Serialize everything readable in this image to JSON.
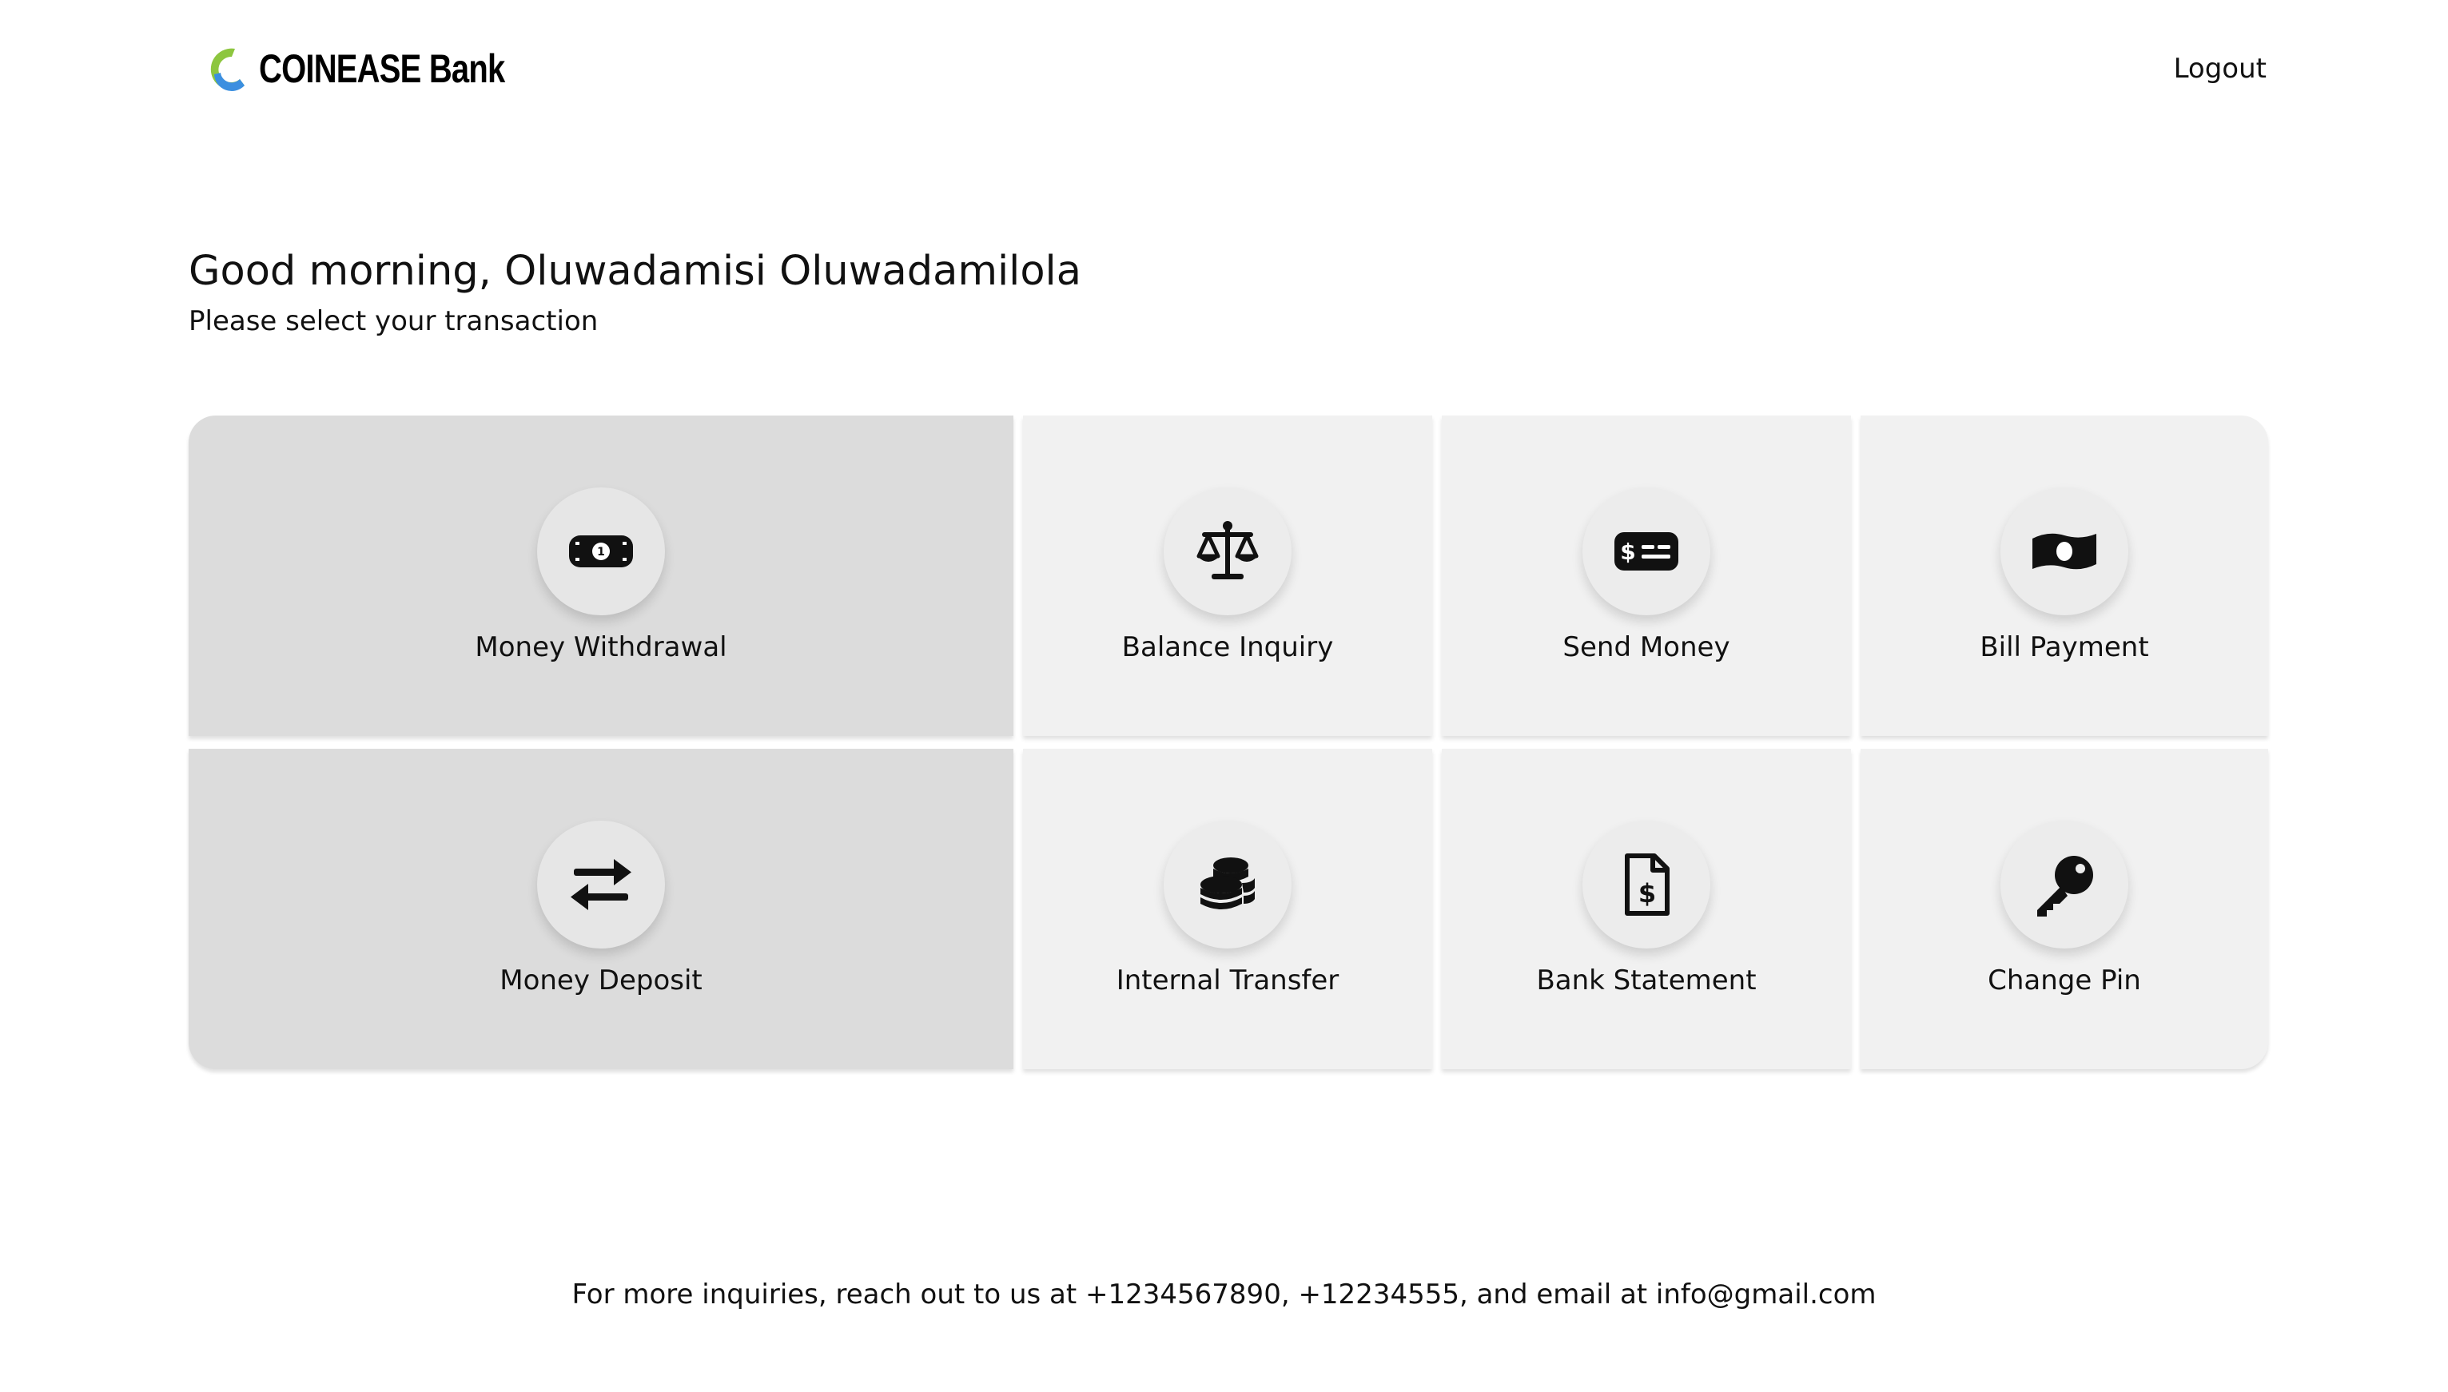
{
  "header": {
    "brand": "COINEASE Bank",
    "logout_label": "Logout"
  },
  "main": {
    "greeting": "Good morning, Oluwadamisi Oluwadamilola",
    "subtitle": "Please select your transaction"
  },
  "transactions": [
    {
      "label": "Money Withdrawal",
      "icon": "money-bill-icon",
      "selected": true
    },
    {
      "label": "Balance Inquiry",
      "icon": "scale-balanced-icon",
      "selected": false
    },
    {
      "label": "Send Money",
      "icon": "money-check-dollar-icon",
      "selected": false
    },
    {
      "label": "Bill Payment",
      "icon": "money-bill-wave-icon",
      "selected": false
    },
    {
      "label": "Money Deposit",
      "icon": "right-left-arrows-icon",
      "selected": true
    },
    {
      "label": "Internal Transfer",
      "icon": "coins-icon",
      "selected": false
    },
    {
      "label": "Bank Statement",
      "icon": "file-invoice-dollar-icon",
      "selected": false
    },
    {
      "label": "Change Pin",
      "icon": "key-icon",
      "selected": false
    }
  ],
  "footer": {
    "text": "For more inquiries, reach out to us at +1234567890, +12234555, and email at info@gmail.com"
  },
  "colors": {
    "logo_green": "#8dc63f",
    "logo_blue": "#3b8fe0",
    "tile_bg": "#f1f1f1",
    "tile_active_bg": "#dcdcdc"
  }
}
